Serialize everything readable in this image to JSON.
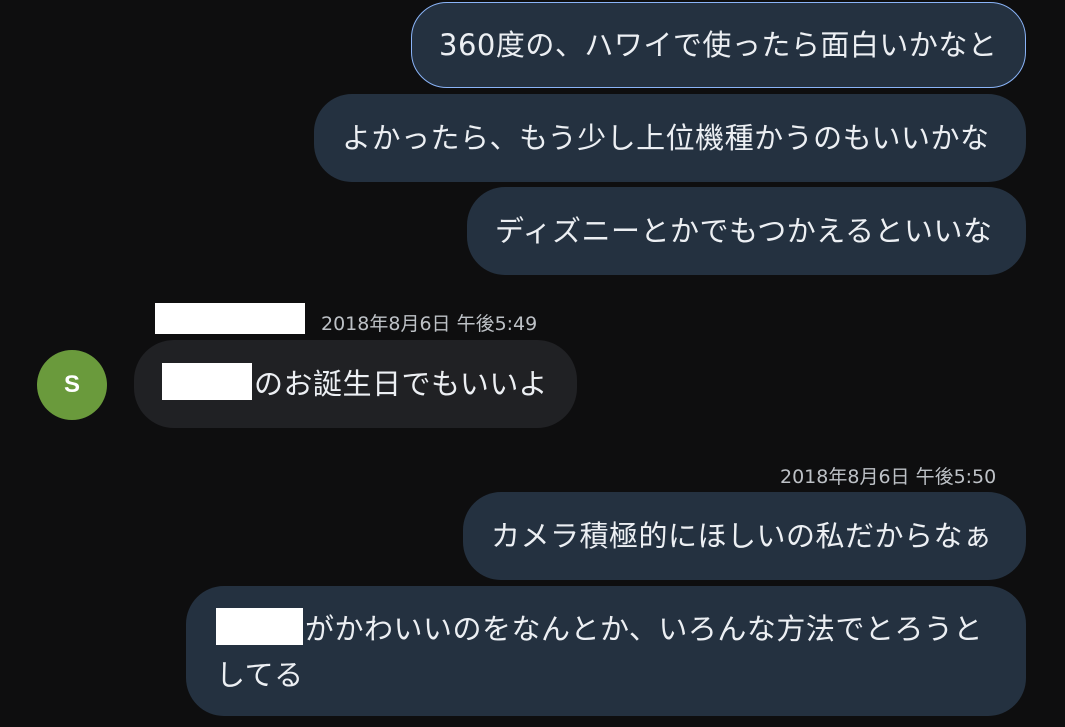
{
  "conversation": {
    "messages": [
      {
        "text": "360度の、ハワイで使ったら面白いかなと"
      },
      {
        "text": "よかったら、もう少し上位機種かうのもいいかな"
      },
      {
        "text": "ディズニーとかでもつかえるといいな"
      },
      {
        "sender_avatar_initial": "S",
        "timestamp": "2018年8月6日 午後5:49",
        "text": "のお誕生日でもいいよ"
      },
      {
        "timestamp": "2018年8月6日 午後5:50",
        "text": "カメラ積極的にほしいの私だからなぁ"
      },
      {
        "text_line1": "がかわいいのをなんとか、いろんな方法でとろうと",
        "text_line2": "してる"
      }
    ]
  },
  "colors": {
    "background": "#0e0e0f",
    "outgoing_bubble": "#243140",
    "incoming_bubble": "#202124",
    "selected_border": "#8ab4f8",
    "avatar": "#6a9a3c"
  }
}
